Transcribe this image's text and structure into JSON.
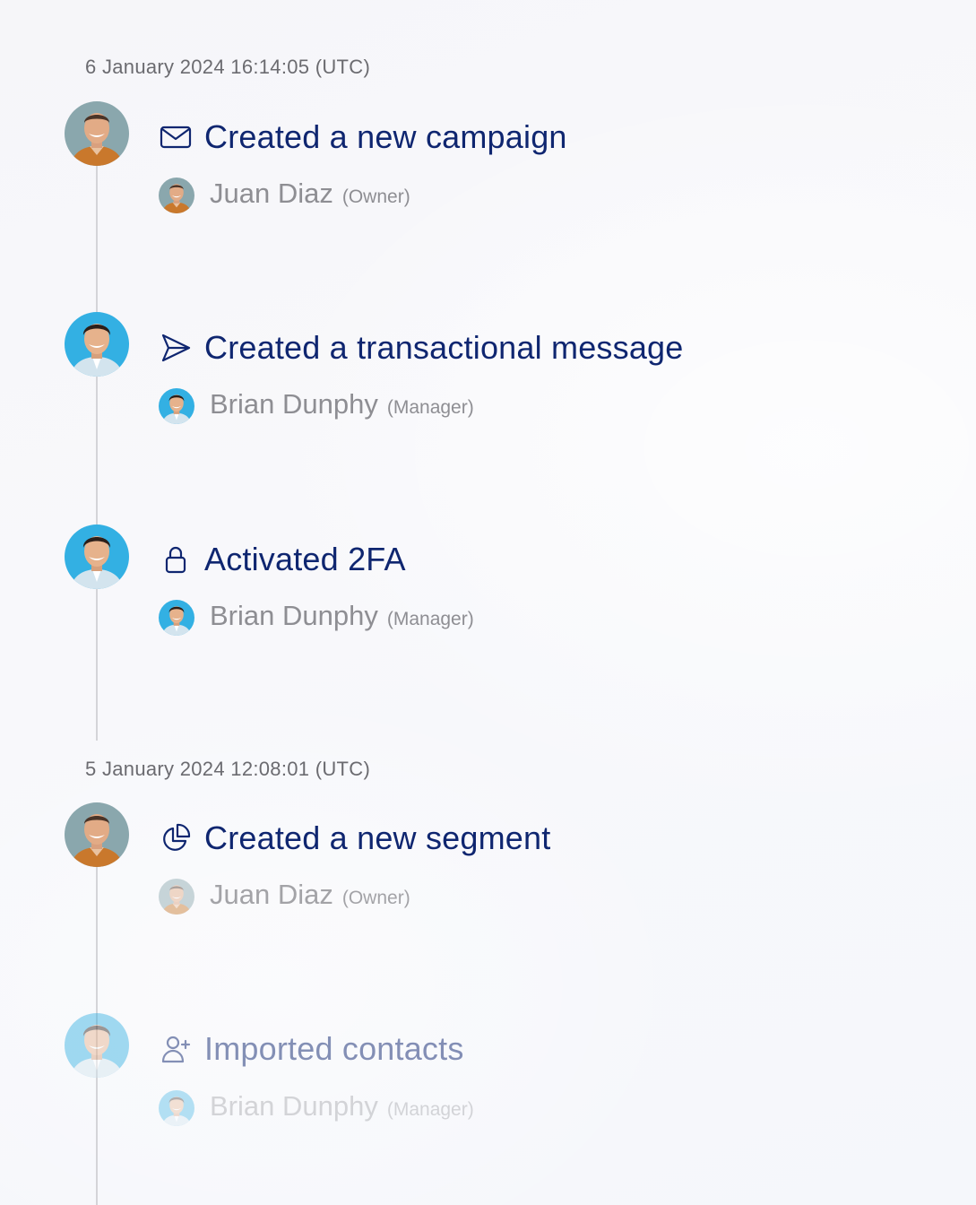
{
  "groups": [
    {
      "date": "6 January 2024 16:14:05 (UTC)",
      "events": [
        {
          "icon": "envelope-icon",
          "title": "Created a new campaign",
          "user": "Juan Diaz",
          "role": "(Owner)"
        },
        {
          "icon": "send-icon",
          "title": "Created a transactional message",
          "user": "Brian Dunphy",
          "role": "(Manager)"
        },
        {
          "icon": "lock-icon",
          "title": "Activated 2FA",
          "user": "Brian Dunphy",
          "role": "(Manager)"
        }
      ]
    },
    {
      "date": "5 January 2024 12:08:01 (UTC)",
      "events": [
        {
          "icon": "pie-chart-icon",
          "title": "Created a new segment",
          "user": "Juan Diaz",
          "role": "(Owner)"
        },
        {
          "icon": "user-plus-icon",
          "title": "Imported contacts",
          "user": "Brian Dunphy",
          "role": "(Manager)"
        }
      ]
    }
  ],
  "colors": {
    "title": "#0f2670",
    "muted": "#8e8e93",
    "date": "#6b6b70",
    "line": "#d4d4d8"
  }
}
